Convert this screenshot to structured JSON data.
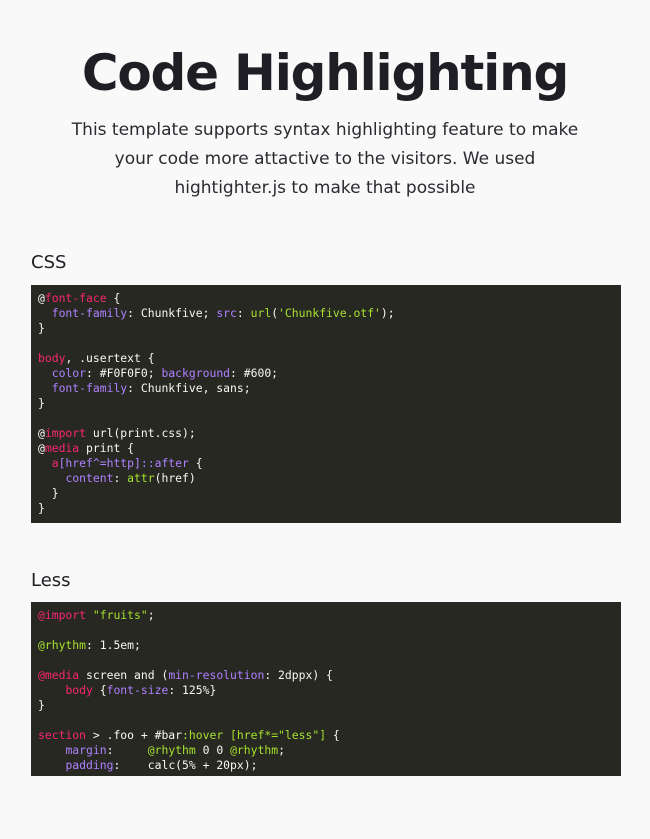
{
  "hero": {
    "title": "Code Highlighting",
    "description": "This template supports syntax highlighting feature to make your code more attactive to the visitors. We used hightighter.js to make that possible"
  },
  "sections": [
    {
      "heading": "CSS",
      "language": "css",
      "lines": [
        [
          {
            "t": "@",
            "c": "at"
          },
          {
            "t": "font-face",
            "c": "kw"
          },
          {
            "t": " {",
            "c": "plain"
          }
        ],
        [
          {
            "t": "  ",
            "c": "plain"
          },
          {
            "t": "font-family",
            "c": "prop"
          },
          {
            "t": ": Chunkfive; ",
            "c": "plain"
          },
          {
            "t": "src",
            "c": "prop"
          },
          {
            "t": ": ",
            "c": "plain"
          },
          {
            "t": "url",
            "c": "fn"
          },
          {
            "t": "(",
            "c": "plain"
          },
          {
            "t": "'Chunkfive.otf'",
            "c": "str"
          },
          {
            "t": ");",
            "c": "plain"
          }
        ],
        [
          {
            "t": "}",
            "c": "plain"
          }
        ],
        [],
        [
          {
            "t": "body",
            "c": "kw"
          },
          {
            "t": ", .usertext {",
            "c": "plain"
          }
        ],
        [
          {
            "t": "  ",
            "c": "plain"
          },
          {
            "t": "color",
            "c": "prop"
          },
          {
            "t": ": #F0F0F0; ",
            "c": "plain"
          },
          {
            "t": "background",
            "c": "prop"
          },
          {
            "t": ": #600;",
            "c": "plain"
          }
        ],
        [
          {
            "t": "  ",
            "c": "plain"
          },
          {
            "t": "font-family",
            "c": "prop"
          },
          {
            "t": ": Chunkfive, sans;",
            "c": "plain"
          }
        ],
        [
          {
            "t": "}",
            "c": "plain"
          }
        ],
        [],
        [
          {
            "t": "@",
            "c": "at"
          },
          {
            "t": "import",
            "c": "kw"
          },
          {
            "t": " url(print.css);",
            "c": "plain"
          }
        ],
        [
          {
            "t": "@",
            "c": "at"
          },
          {
            "t": "media",
            "c": "kw"
          },
          {
            "t": " print {",
            "c": "plain"
          }
        ],
        [
          {
            "t": "  ",
            "c": "plain"
          },
          {
            "t": "a",
            "c": "kw"
          },
          {
            "t": "[href^=http]::after",
            "c": "prop"
          },
          {
            "t": " {",
            "c": "plain"
          }
        ],
        [
          {
            "t": "    ",
            "c": "plain"
          },
          {
            "t": "content",
            "c": "prop"
          },
          {
            "t": ": ",
            "c": "plain"
          },
          {
            "t": "attr",
            "c": "fn"
          },
          {
            "t": "(href)",
            "c": "plain"
          }
        ],
        [
          {
            "t": "  }",
            "c": "plain"
          }
        ],
        [
          {
            "t": "}",
            "c": "plain"
          }
        ]
      ]
    },
    {
      "heading": "Less",
      "language": "less",
      "lines": [
        [
          {
            "t": "@import",
            "c": "kw"
          },
          {
            "t": " ",
            "c": "plain"
          },
          {
            "t": "\"fruits\"",
            "c": "str"
          },
          {
            "t": ";",
            "c": "plain"
          }
        ],
        [],
        [
          {
            "t": "@rhythm",
            "c": "var"
          },
          {
            "t": ": 1.5em;",
            "c": "plain"
          }
        ],
        [],
        [
          {
            "t": "@media",
            "c": "kw"
          },
          {
            "t": " screen and (",
            "c": "plain"
          },
          {
            "t": "min-resolution",
            "c": "prop"
          },
          {
            "t": ": 2dppx) {",
            "c": "plain"
          }
        ],
        [
          {
            "t": "    ",
            "c": "plain"
          },
          {
            "t": "body",
            "c": "kw"
          },
          {
            "t": " {",
            "c": "plain"
          },
          {
            "t": "font-size",
            "c": "prop"
          },
          {
            "t": ": 125%}",
            "c": "plain"
          }
        ],
        [
          {
            "t": "}",
            "c": "plain"
          }
        ],
        [],
        [
          {
            "t": "section",
            "c": "kw"
          },
          {
            "t": " > .foo + #bar",
            "c": "plain"
          },
          {
            "t": ":hover",
            "c": "str"
          },
          {
            "t": " ",
            "c": "plain"
          },
          {
            "t": "[href*=\"less\"]",
            "c": "str"
          },
          {
            "t": " {",
            "c": "plain"
          }
        ],
        [
          {
            "t": "    ",
            "c": "plain"
          },
          {
            "t": "margin",
            "c": "prop"
          },
          {
            "t": ":     ",
            "c": "plain"
          },
          {
            "t": "@rhythm",
            "c": "var"
          },
          {
            "t": " 0 0 ",
            "c": "plain"
          },
          {
            "t": "@rhythm",
            "c": "var"
          },
          {
            "t": ";",
            "c": "plain"
          }
        ],
        [
          {
            "t": "    ",
            "c": "plain"
          },
          {
            "t": "padding",
            "c": "prop"
          },
          {
            "t": ":    calc(5% + 20px);",
            "c": "plain"
          }
        ]
      ]
    }
  ],
  "colors": {
    "background": "#f9f9f9",
    "code_background": "#272822",
    "code_text": "#f8f8f2",
    "keyword": "#f92672",
    "property": "#ae81ff",
    "string": "#a6e22e"
  }
}
